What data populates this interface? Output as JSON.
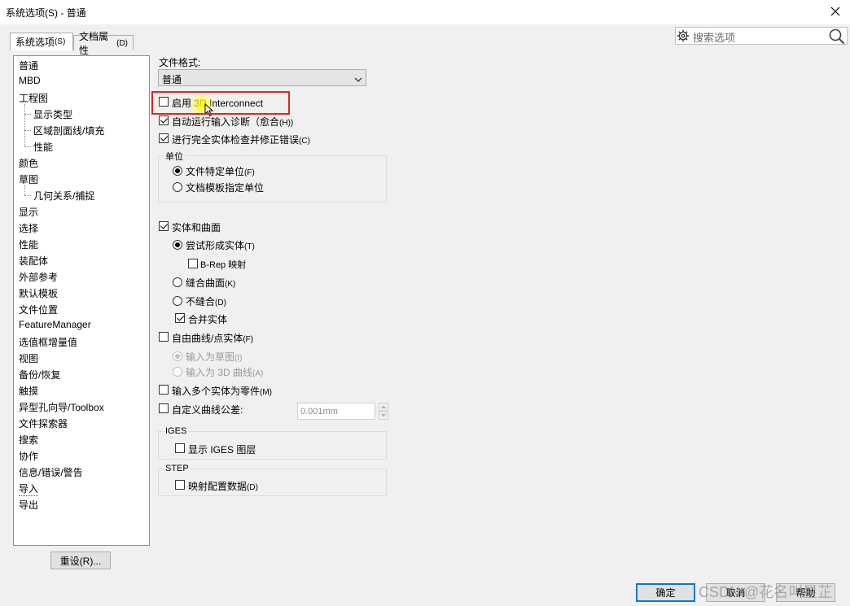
{
  "window": {
    "title": "系统选项(S) - 普通"
  },
  "tabs": [
    {
      "label": "系统选项",
      "hotkey": "(S)"
    },
    {
      "label": "文档属性",
      "hotkey": "(D)"
    }
  ],
  "search": {
    "placeholder": "搜索选项"
  },
  "tree": [
    {
      "label": "普通",
      "level": 0
    },
    {
      "label": "MBD",
      "level": 0
    },
    {
      "label": "工程图",
      "level": 0
    },
    {
      "label": "显示类型",
      "level": 1
    },
    {
      "label": "区域剖面线/填充",
      "level": 1
    },
    {
      "label": "性能",
      "level": 1
    },
    {
      "label": "颜色",
      "level": 0
    },
    {
      "label": "草图",
      "level": 0
    },
    {
      "label": "几何关系/捕捉",
      "level": 1
    },
    {
      "label": "显示",
      "level": 0
    },
    {
      "label": "选择",
      "level": 0
    },
    {
      "label": "性能",
      "level": 0
    },
    {
      "label": "装配体",
      "level": 0
    },
    {
      "label": "外部参考",
      "level": 0
    },
    {
      "label": "默认模板",
      "level": 0
    },
    {
      "label": "文件位置",
      "level": 0
    },
    {
      "label": "FeatureManager",
      "level": 0
    },
    {
      "label": "选值框增量值",
      "level": 0
    },
    {
      "label": "视图",
      "level": 0
    },
    {
      "label": "备份/恢复",
      "level": 0
    },
    {
      "label": "触摸",
      "level": 0
    },
    {
      "label": "异型孔向导/Toolbox",
      "level": 0
    },
    {
      "label": "文件探索器",
      "level": 0
    },
    {
      "label": "搜索",
      "level": 0
    },
    {
      "label": "协作",
      "level": 0
    },
    {
      "label": "信息/错误/警告",
      "level": 0
    },
    {
      "label": "导入",
      "level": 0,
      "selected": true
    },
    {
      "label": "导出",
      "level": 0
    }
  ],
  "reset_button": "重设(R)...",
  "file_format": {
    "label": "文件格式:",
    "value": "普通"
  },
  "options": {
    "enable_3d_interconnect": {
      "label": "启用 3D Interconnect",
      "checked": false
    },
    "auto_diagnose": {
      "label": "自动运行输入诊断（愈合",
      "hotkey": "(H))",
      "checked": true
    },
    "full_check": {
      "label": "进行完全实体检查并修正错误",
      "hotkey": "(C)",
      "checked": true
    }
  },
  "units_group": {
    "title": "单位",
    "file_units": {
      "label": "文件特定单位",
      "hotkey": "(F)",
      "checked": true
    },
    "template_units": {
      "label": "文档模板指定单位",
      "checked": false
    }
  },
  "solids_surfaces": {
    "label": "实体和曲面",
    "checked": true,
    "try_solid": {
      "label": "尝试形成实体",
      "hotkey": "(T)",
      "checked": true
    },
    "brep_mapping": {
      "label": "B-Rep 映射",
      "checked": false
    },
    "knit_surfaces": {
      "label": "缝合曲面",
      "hotkey": "(K)",
      "checked": false
    },
    "no_knit": {
      "label": "不缝合",
      "hotkey": "(D)",
      "checked": false
    },
    "merge_solids": {
      "label": "合并实体",
      "checked": true
    }
  },
  "free_curves": {
    "label": "自由曲线/点实体",
    "hotkey": "(F)",
    "checked": false,
    "as_sketch": {
      "label": "输入为草图",
      "hotkey": "(I)",
      "checked": true
    },
    "as_3d_curve": {
      "label": "输入为 3D 曲线",
      "hotkey": "(A)",
      "checked": false
    }
  },
  "multi_body_parts": {
    "label": "输入多个实体为零件",
    "hotkey": "(M)",
    "checked": false
  },
  "custom_tolerance": {
    "label": "自定义曲线公差:",
    "checked": false,
    "value": "0.001mm"
  },
  "iges_group": {
    "title": "IGES",
    "show_layers": {
      "label": "显示 IGES 图层",
      "checked": false
    }
  },
  "step_group": {
    "title": "STEP",
    "map_config": {
      "label": "映射配置数据",
      "hotkey": "(D)",
      "checked": false
    }
  },
  "footer": {
    "ok": "确定",
    "cancel": "取消",
    "help": "帮助"
  },
  "watermark": "CSDN @花名叫星芷",
  "colors": {
    "highlight": "#e0261c",
    "accent": "#0078d7"
  }
}
